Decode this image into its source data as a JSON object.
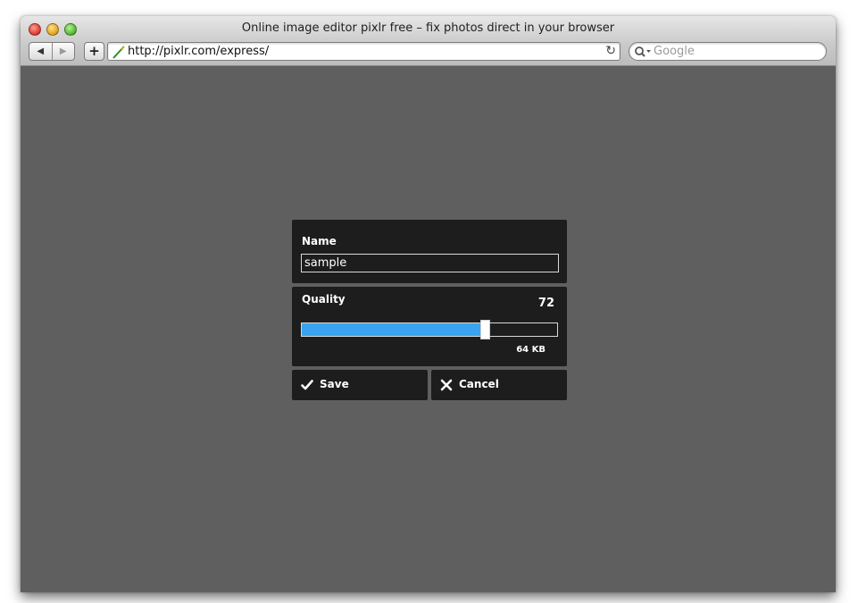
{
  "browser": {
    "window_title": "Online image editor pixlr free – fix photos direct in your browser",
    "url": "http://pixlr.com/express/",
    "search_placeholder": "Google",
    "nav": {
      "back_glyph": "◀",
      "forward_glyph": "▶",
      "add_glyph": "+",
      "reload_glyph": "↻"
    }
  },
  "dialog": {
    "name_label": "Name",
    "name_value": "sample",
    "quality_label": "Quality",
    "quality_value": "72",
    "quality_fraction": 0.72,
    "file_size": "64 KB",
    "save_label": "Save",
    "cancel_label": "Cancel"
  },
  "colors": {
    "page_background": "#5f5f5f",
    "panel_background": "#1d1d1d",
    "slider_fill": "#3aa3f0"
  },
  "icons": [
    "close-window-icon",
    "minimize-icon",
    "zoom-icon",
    "back-arrow-icon",
    "forward-arrow-icon",
    "add-icon",
    "favicon-icon",
    "reload-icon",
    "search-icon",
    "checkmark-icon",
    "x-icon"
  ]
}
